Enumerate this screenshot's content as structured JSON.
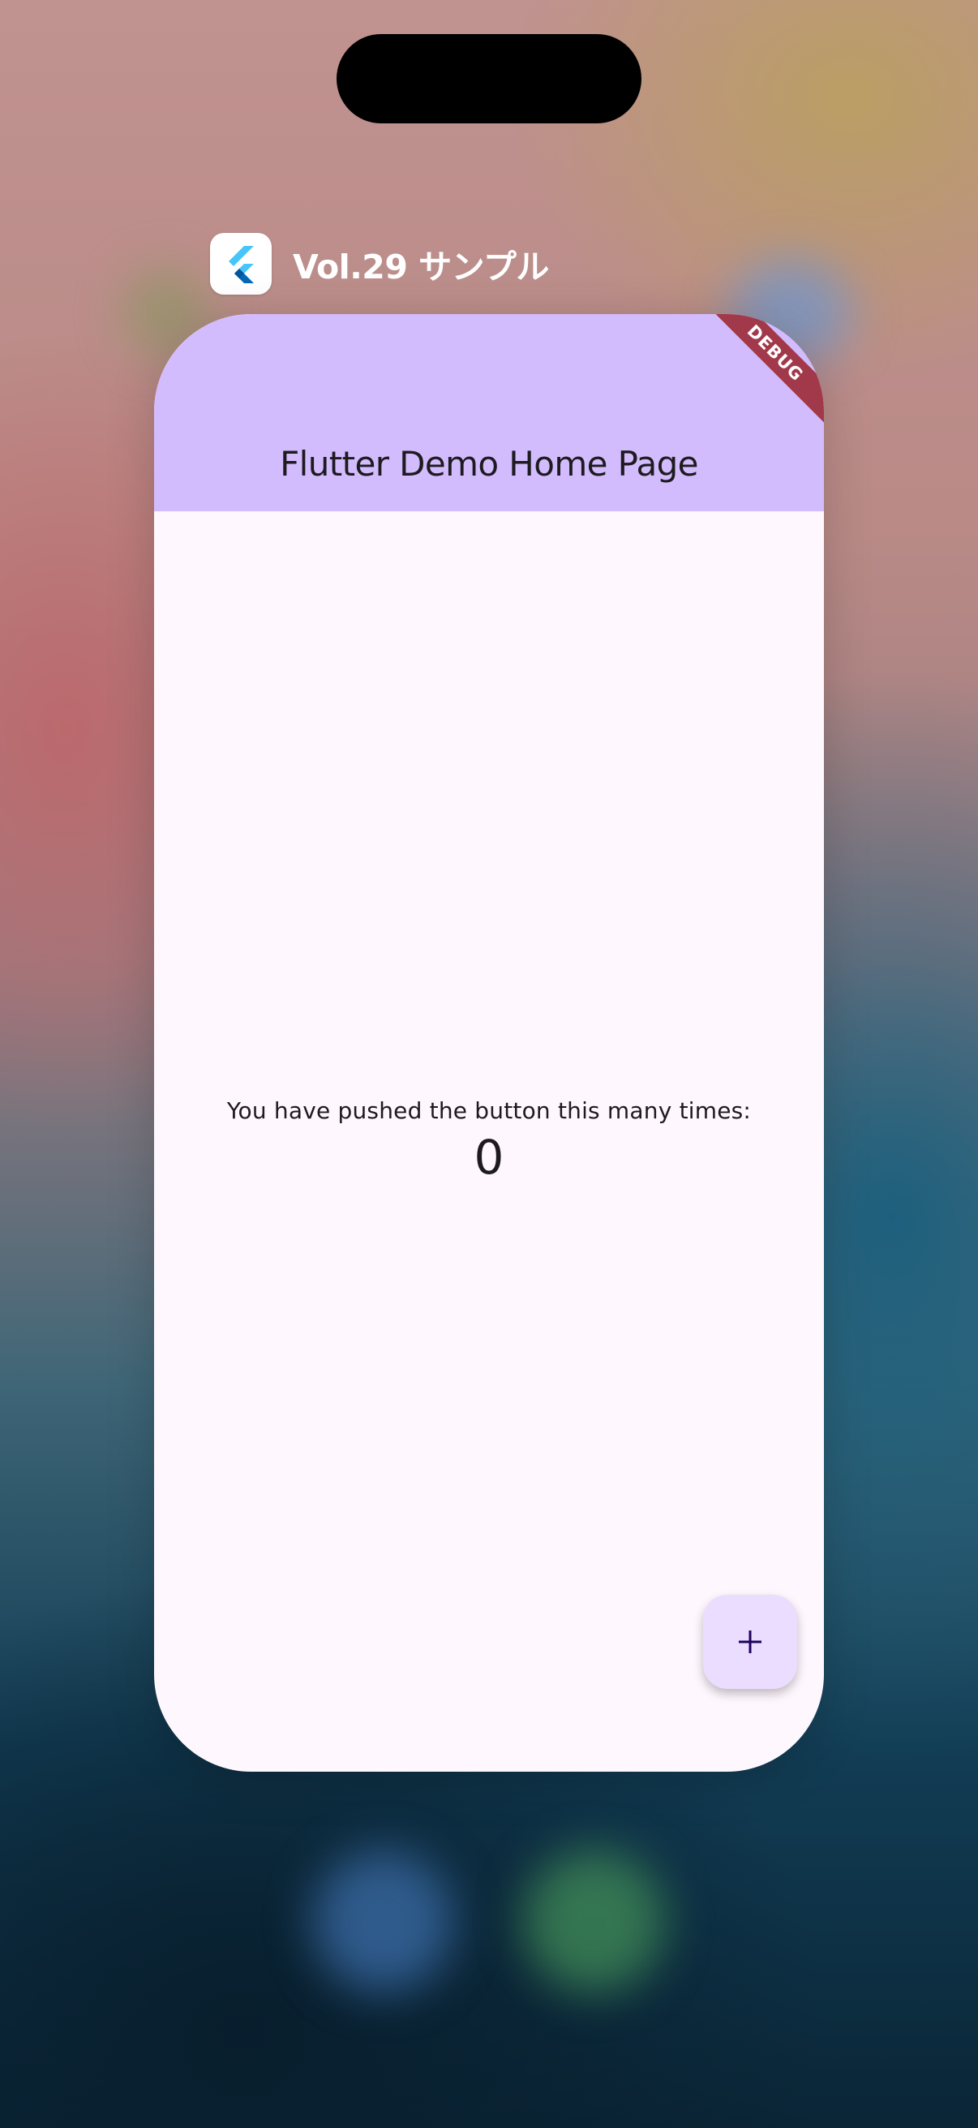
{
  "app_switcher": {
    "app_name": "Vol.29 サンプル",
    "app_icon": "flutter-logo-icon"
  },
  "app": {
    "app_bar_title": "Flutter Demo Home Page",
    "debug_banner": "DEBUG",
    "counter_label": "You have pushed the button this many times:",
    "counter_value": "0",
    "fab_icon": "plus-icon"
  },
  "colors": {
    "app_bar": "#d3bcfd",
    "app_background": "#fff7fe",
    "fab": "#eaddff",
    "debug_banner": "#a2394a",
    "flutter_light_blue": "#47c5fb",
    "flutter_dark_blue": "#0468b7"
  }
}
